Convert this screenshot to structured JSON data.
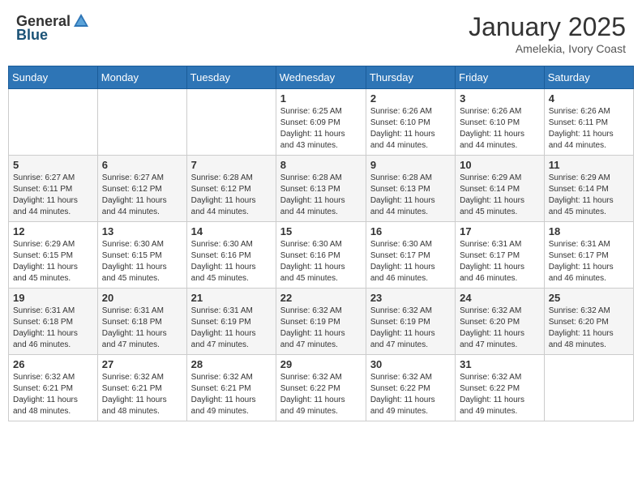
{
  "header": {
    "logo_general": "General",
    "logo_blue": "Blue",
    "month_title": "January 2025",
    "subtitle": "Amelekia, Ivory Coast"
  },
  "weekdays": [
    "Sunday",
    "Monday",
    "Tuesday",
    "Wednesday",
    "Thursday",
    "Friday",
    "Saturday"
  ],
  "weeks": [
    [
      {
        "day": "",
        "info": ""
      },
      {
        "day": "",
        "info": ""
      },
      {
        "day": "",
        "info": ""
      },
      {
        "day": "1",
        "info": "Sunrise: 6:25 AM\nSunset: 6:09 PM\nDaylight: 11 hours\nand 43 minutes."
      },
      {
        "day": "2",
        "info": "Sunrise: 6:26 AM\nSunset: 6:10 PM\nDaylight: 11 hours\nand 44 minutes."
      },
      {
        "day": "3",
        "info": "Sunrise: 6:26 AM\nSunset: 6:10 PM\nDaylight: 11 hours\nand 44 minutes."
      },
      {
        "day": "4",
        "info": "Sunrise: 6:26 AM\nSunset: 6:11 PM\nDaylight: 11 hours\nand 44 minutes."
      }
    ],
    [
      {
        "day": "5",
        "info": "Sunrise: 6:27 AM\nSunset: 6:11 PM\nDaylight: 11 hours\nand 44 minutes."
      },
      {
        "day": "6",
        "info": "Sunrise: 6:27 AM\nSunset: 6:12 PM\nDaylight: 11 hours\nand 44 minutes."
      },
      {
        "day": "7",
        "info": "Sunrise: 6:28 AM\nSunset: 6:12 PM\nDaylight: 11 hours\nand 44 minutes."
      },
      {
        "day": "8",
        "info": "Sunrise: 6:28 AM\nSunset: 6:13 PM\nDaylight: 11 hours\nand 44 minutes."
      },
      {
        "day": "9",
        "info": "Sunrise: 6:28 AM\nSunset: 6:13 PM\nDaylight: 11 hours\nand 44 minutes."
      },
      {
        "day": "10",
        "info": "Sunrise: 6:29 AM\nSunset: 6:14 PM\nDaylight: 11 hours\nand 45 minutes."
      },
      {
        "day": "11",
        "info": "Sunrise: 6:29 AM\nSunset: 6:14 PM\nDaylight: 11 hours\nand 45 minutes."
      }
    ],
    [
      {
        "day": "12",
        "info": "Sunrise: 6:29 AM\nSunset: 6:15 PM\nDaylight: 11 hours\nand 45 minutes."
      },
      {
        "day": "13",
        "info": "Sunrise: 6:30 AM\nSunset: 6:15 PM\nDaylight: 11 hours\nand 45 minutes."
      },
      {
        "day": "14",
        "info": "Sunrise: 6:30 AM\nSunset: 6:16 PM\nDaylight: 11 hours\nand 45 minutes."
      },
      {
        "day": "15",
        "info": "Sunrise: 6:30 AM\nSunset: 6:16 PM\nDaylight: 11 hours\nand 45 minutes."
      },
      {
        "day": "16",
        "info": "Sunrise: 6:30 AM\nSunset: 6:17 PM\nDaylight: 11 hours\nand 46 minutes."
      },
      {
        "day": "17",
        "info": "Sunrise: 6:31 AM\nSunset: 6:17 PM\nDaylight: 11 hours\nand 46 minutes."
      },
      {
        "day": "18",
        "info": "Sunrise: 6:31 AM\nSunset: 6:17 PM\nDaylight: 11 hours\nand 46 minutes."
      }
    ],
    [
      {
        "day": "19",
        "info": "Sunrise: 6:31 AM\nSunset: 6:18 PM\nDaylight: 11 hours\nand 46 minutes."
      },
      {
        "day": "20",
        "info": "Sunrise: 6:31 AM\nSunset: 6:18 PM\nDaylight: 11 hours\nand 47 minutes."
      },
      {
        "day": "21",
        "info": "Sunrise: 6:31 AM\nSunset: 6:19 PM\nDaylight: 11 hours\nand 47 minutes."
      },
      {
        "day": "22",
        "info": "Sunrise: 6:32 AM\nSunset: 6:19 PM\nDaylight: 11 hours\nand 47 minutes."
      },
      {
        "day": "23",
        "info": "Sunrise: 6:32 AM\nSunset: 6:19 PM\nDaylight: 11 hours\nand 47 minutes."
      },
      {
        "day": "24",
        "info": "Sunrise: 6:32 AM\nSunset: 6:20 PM\nDaylight: 11 hours\nand 47 minutes."
      },
      {
        "day": "25",
        "info": "Sunrise: 6:32 AM\nSunset: 6:20 PM\nDaylight: 11 hours\nand 48 minutes."
      }
    ],
    [
      {
        "day": "26",
        "info": "Sunrise: 6:32 AM\nSunset: 6:21 PM\nDaylight: 11 hours\nand 48 minutes."
      },
      {
        "day": "27",
        "info": "Sunrise: 6:32 AM\nSunset: 6:21 PM\nDaylight: 11 hours\nand 48 minutes."
      },
      {
        "day": "28",
        "info": "Sunrise: 6:32 AM\nSunset: 6:21 PM\nDaylight: 11 hours\nand 49 minutes."
      },
      {
        "day": "29",
        "info": "Sunrise: 6:32 AM\nSunset: 6:22 PM\nDaylight: 11 hours\nand 49 minutes."
      },
      {
        "day": "30",
        "info": "Sunrise: 6:32 AM\nSunset: 6:22 PM\nDaylight: 11 hours\nand 49 minutes."
      },
      {
        "day": "31",
        "info": "Sunrise: 6:32 AM\nSunset: 6:22 PM\nDaylight: 11 hours\nand 49 minutes."
      },
      {
        "day": "",
        "info": ""
      }
    ]
  ]
}
